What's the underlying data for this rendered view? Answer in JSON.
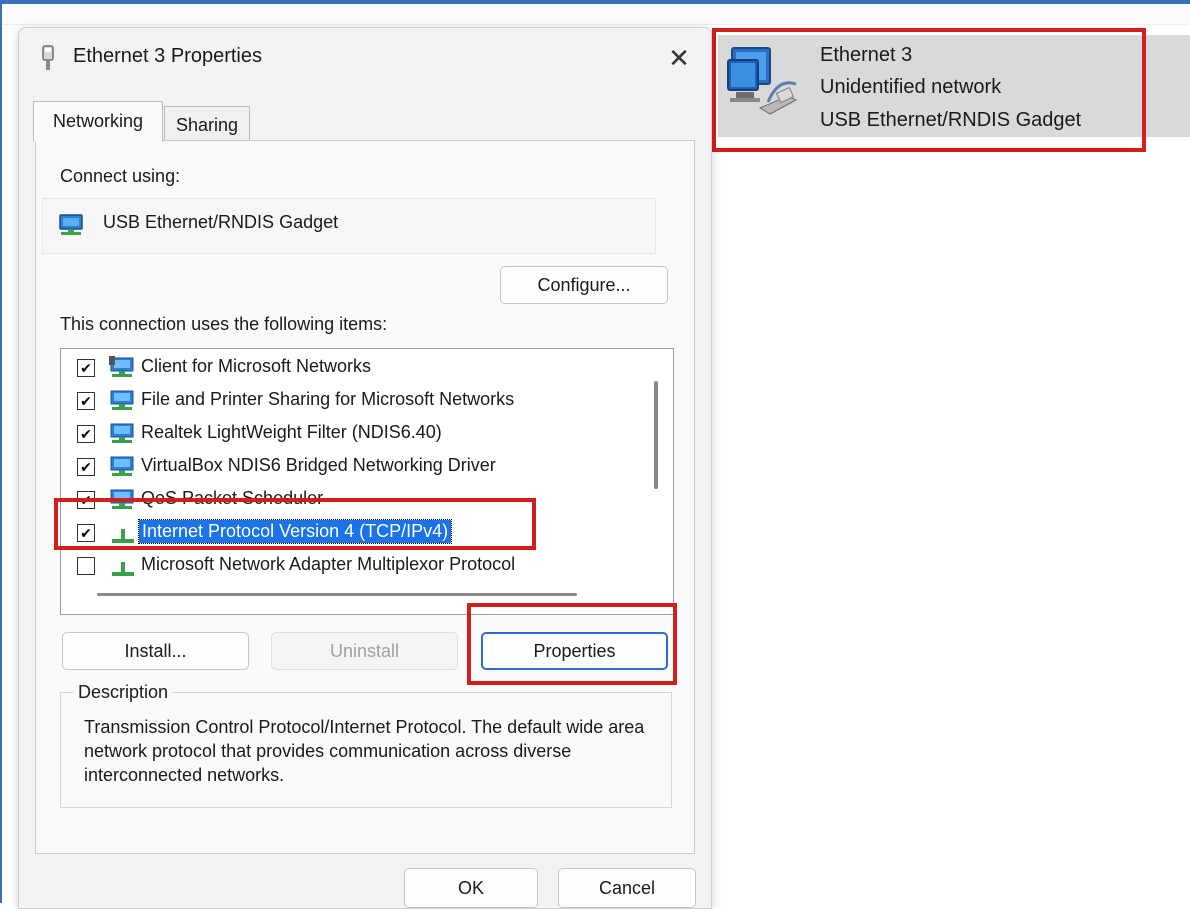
{
  "dialog": {
    "title": "Ethernet 3 Properties",
    "close_glyph": "✕",
    "tabs": [
      {
        "label": "Networking",
        "active": true
      },
      {
        "label": "Sharing",
        "active": false
      }
    ],
    "connect_using_label": "Connect using:",
    "adapter_name": "USB Ethernet/RNDIS Gadget",
    "configure_label": "Configure...",
    "items_label": "This connection uses the following items:",
    "items": [
      {
        "label": "Client for Microsoft Networks",
        "checked": true,
        "icon": "network-client-icon"
      },
      {
        "label": "File and Printer Sharing for Microsoft Networks",
        "checked": true,
        "icon": "network-service-icon"
      },
      {
        "label": "Realtek LightWeight Filter (NDIS6.40)",
        "checked": true,
        "icon": "network-service-icon"
      },
      {
        "label": "VirtualBox NDIS6 Bridged Networking Driver",
        "checked": true,
        "icon": "network-service-icon"
      },
      {
        "label": "QoS Packet Scheduler",
        "checked": true,
        "icon": "network-service-icon"
      },
      {
        "label": "Internet Protocol Version 4 (TCP/IPv4)",
        "checked": true,
        "icon": "protocol-icon",
        "selected": true
      },
      {
        "label": "Microsoft Network Adapter Multiplexor Protocol",
        "checked": false,
        "icon": "protocol-icon"
      }
    ],
    "install_label": "Install...",
    "uninstall_label": "Uninstall",
    "properties_label": "Properties",
    "description_legend": "Description",
    "description_text": "Transmission Control Protocol/Internet Protocol. The default wide area network protocol that provides communication across diverse interconnected networks.",
    "ok_label": "OK",
    "cancel_label": "Cancel"
  },
  "network_card": {
    "name": "Ethernet 3",
    "status": "Unidentified network",
    "device": "USB Ethernet/RNDIS Gadget",
    "icon": "network-adapter-icon"
  },
  "colors": {
    "highlight_red": "#d0201e",
    "selection_blue": "#1a73e8",
    "window_border": "#3d6fbf"
  }
}
